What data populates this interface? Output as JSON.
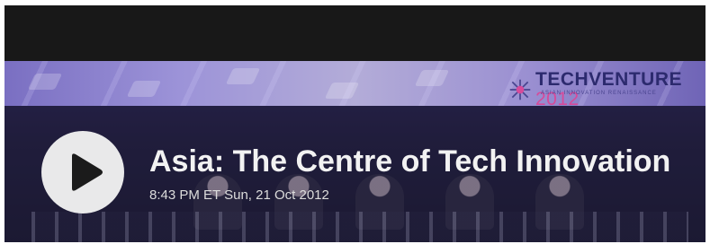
{
  "video": {
    "title": "Asia: The Centre of Tech Innovation",
    "timestamp": "8:43 PM ET Sun, 21 Oct 2012",
    "play_icon": "play-icon"
  },
  "banner": {
    "logo_main": "TECHVENTURE",
    "logo_year": "2012",
    "logo_sub": "ASIAN INNOVATION RENAISSANCE",
    "brand_colors": [
      "#2c2a6e",
      "#d64a9a"
    ]
  },
  "colors": {
    "play_button": "#e9e9ea",
    "title_text": "#f2f2f2",
    "timestamp_text": "#dcdcdc"
  }
}
